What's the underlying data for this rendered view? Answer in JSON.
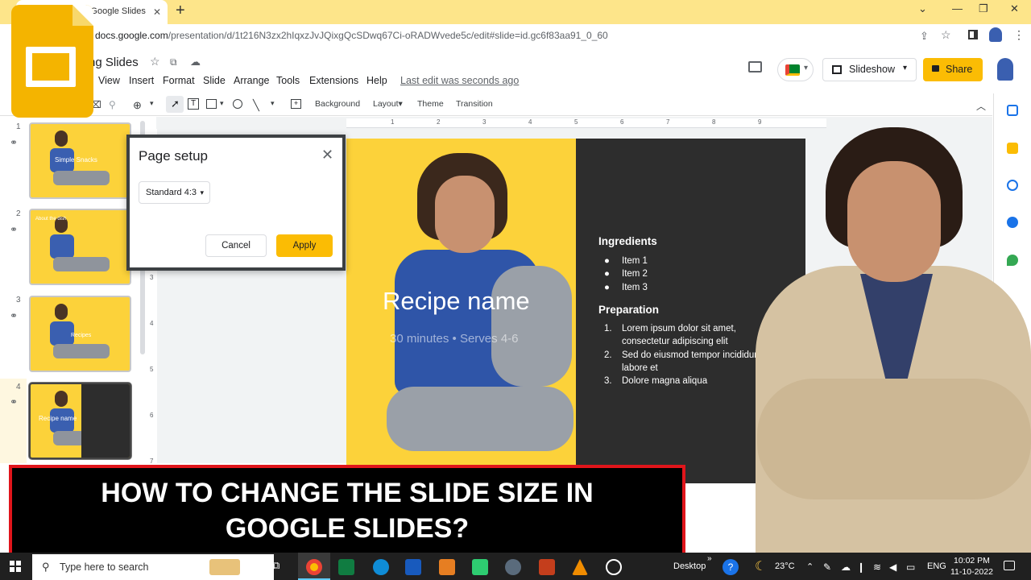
{
  "browser": {
    "tab_title": "lides - Google Slides",
    "url_host": "docs.google.com",
    "url_path": "/presentation/d/1t216N3zx2hIqxzJvJQixgQcSDwq67Ci-oRADWvede5c/edit#slide=id.gc6f83aa91_0_60",
    "new_tab": "+",
    "tab_close": "✕",
    "minimize": "⌄",
    "restore": "—",
    "maximize": "❐",
    "close": "✕"
  },
  "doc": {
    "title": "ng Slides",
    "menu": [
      "View",
      "Insert",
      "Format",
      "Slide",
      "Arrange",
      "Tools",
      "Extensions",
      "Help"
    ],
    "last_edit": "Last edit was seconds ago",
    "slideshow_label": "Slideshow",
    "share_label": "Share"
  },
  "toolbar": {
    "background": "Background",
    "layout": "Layout▾",
    "theme": "Theme",
    "transition": "Transition"
  },
  "filmstrip": {
    "slides": [
      {
        "num": "1",
        "label": "Simple Snacks"
      },
      {
        "num": "2",
        "label": "About the dish"
      },
      {
        "num": "3",
        "label": "Recipes"
      },
      {
        "num": "4",
        "label": "Recipe name"
      }
    ]
  },
  "ruler": {
    "top_ticks": [
      "1",
      "2",
      "3",
      "4",
      "5",
      "6",
      "7",
      "8",
      "9"
    ],
    "left_ticks": [
      "3",
      "4",
      "5",
      "6",
      "7"
    ]
  },
  "slide": {
    "recipe_name": "Recipe name",
    "recipe_sub": "30 minutes • Serves 4-6",
    "ingredients_title": "Ingredients",
    "ingredients": [
      "Item 1",
      "Item 2",
      "Item 3"
    ],
    "preparation_title": "Preparation",
    "steps": [
      {
        "n": "1.",
        "lines": [
          "Lorem ipsum dolor sit amet,",
          "consectetur adipiscing elit"
        ]
      },
      {
        "n": "2.",
        "lines": [
          "Sed do eiusmod tempor incididunt",
          "labore et"
        ]
      },
      {
        "n": "3.",
        "lines": [
          "Dolore magna aliqua"
        ]
      }
    ]
  },
  "dialog": {
    "title": "Page setup",
    "close": "✕",
    "select_value": "Standard 4:3",
    "cancel": "Cancel",
    "apply": "Apply"
  },
  "banner": {
    "line1": "HOW TO CHANGE THE SLIDE SIZE IN",
    "line2": "GOOGLE SLIDES?"
  },
  "taskbar": {
    "search_placeholder": "Type here to search",
    "desktop": "Desktop",
    "weather": "23°C",
    "lang": "ENG",
    "time": "10:02 PM",
    "date": "11-10-2022"
  },
  "colors": {
    "accent_yellow": "#fbbc04",
    "slide_yellow": "#fcd23a",
    "slide_dark": "#2d2d2d",
    "banner_border": "#e0151b"
  }
}
